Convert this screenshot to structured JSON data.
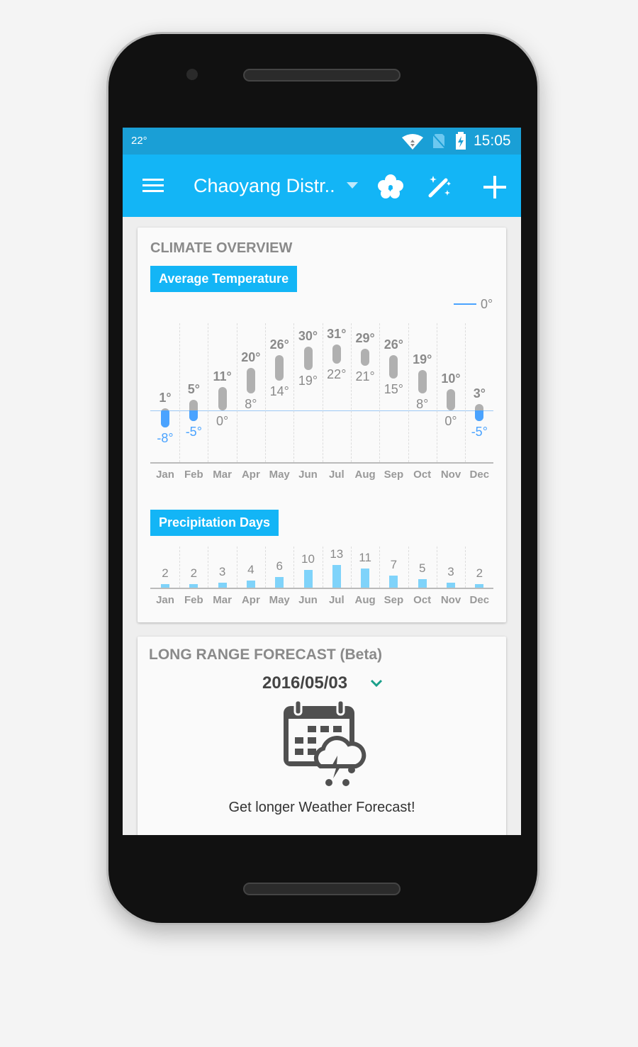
{
  "status_bar": {
    "temperature": "22°",
    "time": "15:05"
  },
  "toolbar": {
    "location": "Chaoyang Distr..",
    "icons": [
      "menu-icon",
      "dropdown-icon",
      "clover-icon",
      "magic-wand-icon",
      "add-icon"
    ]
  },
  "climate": {
    "title": "CLIMATE OVERVIEW",
    "temp_tab": "Average Temperature",
    "legend": "0°",
    "precip_tab": "Precipitation Days",
    "colors": {
      "accent": "#13b5f6",
      "below_zero": "#4aa3ff",
      "bar": "#b0b0b0",
      "precip": "#7fd3fa"
    }
  },
  "chart_data": [
    {
      "type": "bar",
      "title": "Average Temperature",
      "categories": [
        "Jan",
        "Feb",
        "Mar",
        "Apr",
        "May",
        "Jun",
        "Jul",
        "Aug",
        "Sep",
        "Oct",
        "Nov",
        "Dec"
      ],
      "series": [
        {
          "name": "high",
          "values": [
            1,
            5,
            11,
            20,
            26,
            30,
            31,
            29,
            26,
            19,
            10,
            3
          ]
        },
        {
          "name": "low",
          "values": [
            -8,
            -5,
            0,
            8,
            14,
            19,
            22,
            21,
            15,
            8,
            0,
            -5
          ]
        }
      ],
      "reference_line": 0,
      "unit": "°"
    },
    {
      "type": "bar",
      "title": "Precipitation Days",
      "categories": [
        "Jan",
        "Feb",
        "Mar",
        "Apr",
        "May",
        "Jun",
        "Jul",
        "Aug",
        "Sep",
        "Oct",
        "Nov",
        "Dec"
      ],
      "values": [
        2,
        2,
        3,
        4,
        6,
        10,
        13,
        11,
        7,
        5,
        3,
        2
      ]
    }
  ],
  "forecast": {
    "title": "LONG RANGE FORECAST (Beta)",
    "date": "2016/05/03",
    "message": "Get longer Weather Forecast!"
  }
}
